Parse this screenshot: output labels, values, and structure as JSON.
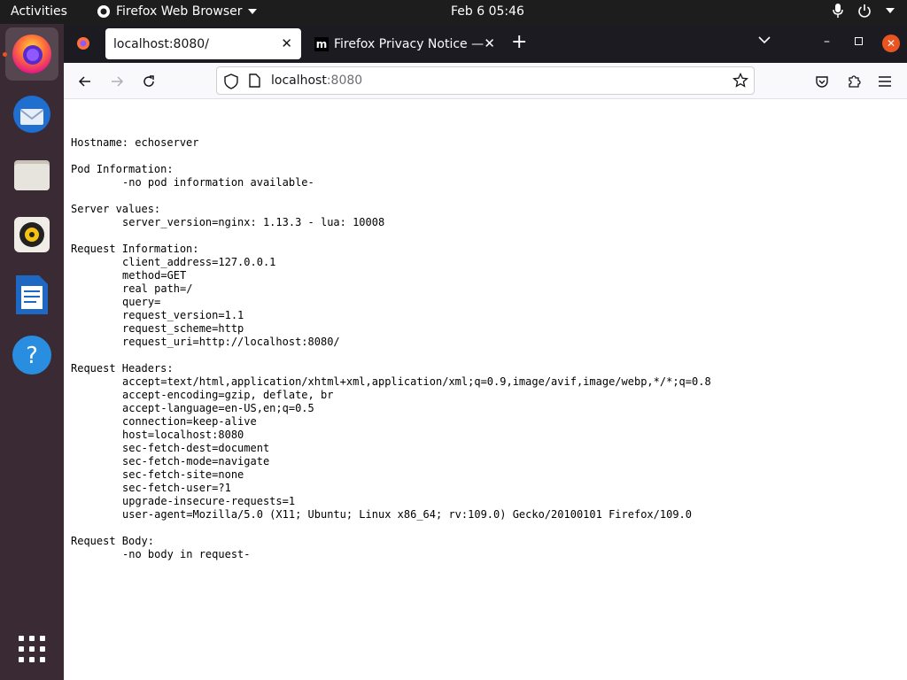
{
  "topbar": {
    "activities": "Activities",
    "app_name": "Firefox Web Browser",
    "clock": "Feb 6  05:46"
  },
  "dock": {
    "items": [
      "firefox-icon",
      "thunderbird-icon",
      "files-icon",
      "rhythmbox-icon",
      "libreoffice-writer-icon",
      "help-icon"
    ],
    "show_apps_icon": "app-grid-icon"
  },
  "tabs": [
    {
      "label": "localhost:8080/",
      "active": true
    },
    {
      "label": "Firefox Privacy Notice —",
      "active": false
    }
  ],
  "urlbar": {
    "host": "localhost",
    "port": ":8080"
  },
  "page": {
    "hostname": "Hostname: echoserver",
    "pod_heading": "Pod Information:",
    "pod_lines": [
      "-no pod information available-"
    ],
    "server_heading": "Server values:",
    "server_lines": [
      "server_version=nginx: 1.13.3 - lua: 10008"
    ],
    "request_heading": "Request Information:",
    "request_lines": [
      "client_address=127.0.0.1",
      "method=GET",
      "real path=/",
      "query=",
      "request_version=1.1",
      "request_scheme=http",
      "request_uri=http://localhost:8080/"
    ],
    "headers_heading": "Request Headers:",
    "headers_lines": [
      "accept=text/html,application/xhtml+xml,application/xml;q=0.9,image/avif,image/webp,*/*;q=0.8",
      "accept-encoding=gzip, deflate, br",
      "accept-language=en-US,en;q=0.5",
      "connection=keep-alive",
      "host=localhost:8080",
      "sec-fetch-dest=document",
      "sec-fetch-mode=navigate",
      "sec-fetch-site=none",
      "sec-fetch-user=?1",
      "upgrade-insecure-requests=1",
      "user-agent=Mozilla/5.0 (X11; Ubuntu; Linux x86_64; rv:109.0) Gecko/20100101 Firefox/109.0"
    ],
    "body_heading": "Request Body:",
    "body_lines": [
      "-no body in request-"
    ]
  },
  "colors": {
    "accent": "#e95420",
    "dock_bg": "#3a2a33",
    "tabbar_bg": "#1c1b22"
  }
}
